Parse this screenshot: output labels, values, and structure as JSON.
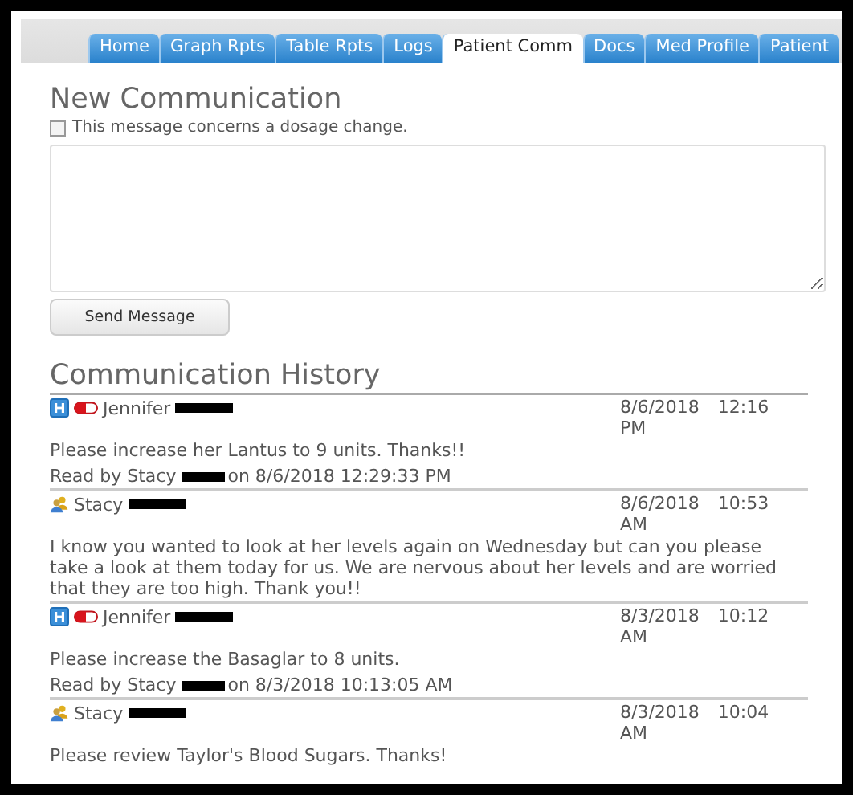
{
  "tabs": [
    {
      "label": "Home",
      "selected": false
    },
    {
      "label": "Graph Rpts",
      "selected": false
    },
    {
      "label": "Table Rpts",
      "selected": false
    },
    {
      "label": "Logs",
      "selected": false
    },
    {
      "label": "Patient Comm",
      "selected": true
    },
    {
      "label": "Docs",
      "selected": false
    },
    {
      "label": "Med Profile",
      "selected": false
    },
    {
      "label": "Patient",
      "selected": false
    }
  ],
  "new_communication": {
    "title": "New Communication",
    "dosage_checkbox": {
      "label": "This message concerns a dosage change.",
      "checked": false
    },
    "send_button": "Send Message"
  },
  "history": {
    "title": "Communication History",
    "entries": [
      {
        "kind": "clinic",
        "author": "Jennifer",
        "redacted": true,
        "datetime": "8/6/2018 12:16 PM",
        "message": "Please increase her Lantus to 9 units. Thanks!!",
        "read_by": "Read by Stacy",
        "read_on": "on 8/6/2018 12:29:33 PM"
      },
      {
        "kind": "family",
        "author": "Stacy",
        "redacted": true,
        "datetime": "8/6/2018 10:53 AM",
        "message": "I know you wanted to look at her levels again on Wednesday but can you please take a look at them today for us. We are nervous about her levels and are worried that they are too high. Thank you!!"
      },
      {
        "kind": "clinic",
        "author": "Jennifer",
        "redacted": true,
        "datetime": "8/3/2018 10:12 AM",
        "message": "Please increase the Basaglar to 8 units.",
        "read_by": "Read by Stacy",
        "read_on": "on 8/3/2018 10:13:05 AM"
      },
      {
        "kind": "family",
        "author": "Stacy",
        "redacted": true,
        "datetime": "8/3/2018 10:04 AM",
        "message": "Please review Taylor's Blood Sugars. Thanks!"
      }
    ]
  }
}
